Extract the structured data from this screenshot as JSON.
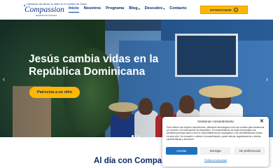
{
  "brand": {
    "tagline": "Liberando del abuso la niñez en el nombre de Jesús",
    "name": "Compassion",
    "sub": "República Dominicana"
  },
  "nav": [
    {
      "label": "Inicio",
      "active": true,
      "dropdown": false
    },
    {
      "label": "Nosotros",
      "active": false,
      "dropdown": false
    },
    {
      "label": "Programa",
      "active": false,
      "dropdown": false
    },
    {
      "label": "Blog",
      "active": false,
      "dropdown": true
    },
    {
      "label": "Descubre",
      "active": false,
      "dropdown": true
    },
    {
      "label": "Contacto",
      "active": false,
      "dropdown": false
    }
  ],
  "header_button": {
    "label": "PATROCINAR",
    "icon": "arrow-right-circle-icon"
  },
  "hero": {
    "title": "Jesús cambia vidas en la República Dominicana",
    "button_label": "Patrocina a un niño",
    "prev_icon": "chevron-left-icon",
    "next_icon": "chevron-right-icon",
    "slides_total": 3,
    "slide_active": 1
  },
  "section": {
    "title": "Al día con Compas"
  },
  "cookie": {
    "title": "Gestionar consentimiento",
    "body": "Para ofrecer las mejores experiencias, utilizamos tecnologías como las cookies para almacenar y/o acceder a la información del dispositivo. El consentimiento de estas tecnologías nos permitirá procesar datos como el comportamiento de navegación o las identificaciones únicas en este sitio. No consentir o retirar el consentimiento, puede afectar negativamente a ciertas características y funciones.",
    "accept": "Aceptar",
    "deny": "Denegar",
    "prefs": "Ver preferencias",
    "policy_link": "Política de privacidad"
  },
  "colors": {
    "primary": "#0a2a66",
    "accent": "#ffb703",
    "link": "#1e73be"
  }
}
